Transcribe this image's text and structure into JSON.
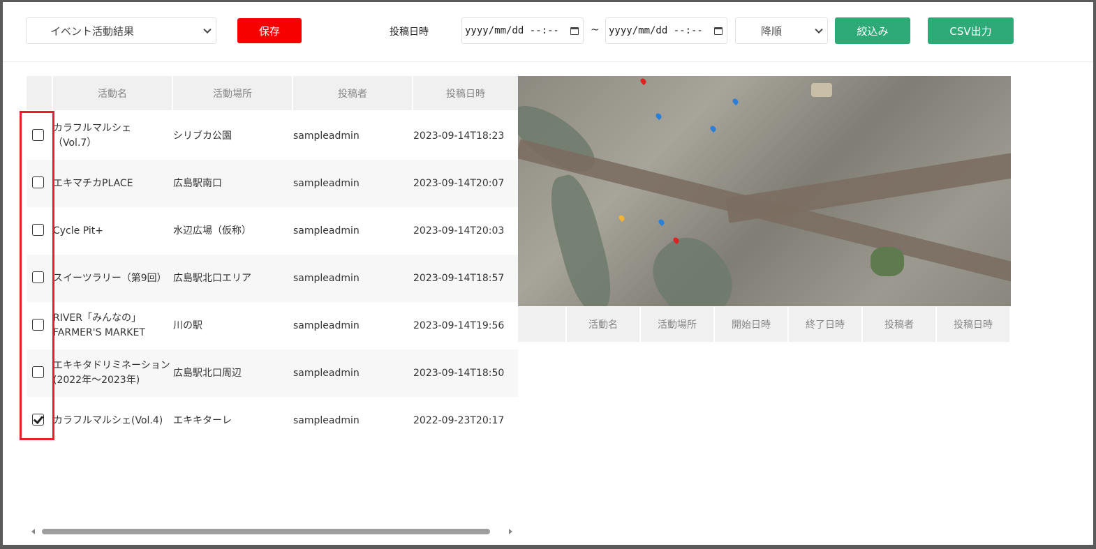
{
  "toolbar": {
    "type_select": "イベント活動結果",
    "save_label": "保存",
    "date_label": "投稿日時",
    "date_from_placeholder": "yyyy/mm/dd --:--",
    "date_to_placeholder": "yyyy/mm/dd --:--",
    "range_separator": "~",
    "order_select": "降順",
    "filter_label": "絞込み",
    "csv_label": "CSV出力"
  },
  "table": {
    "columns": [
      "活動名",
      "活動場所",
      "投稿者",
      "投稿日時"
    ],
    "rows": [
      {
        "name": "カラフルマルシェ（Vol.7）",
        "name_line1": "カラフルマルシェ",
        "name_line2": "（Vol.7）",
        "place": "シリブカ公園",
        "poster": "sampleadmin",
        "date": "2023-09-14T18:23",
        "checked": false
      },
      {
        "name_line1": "エキマチカPLACE",
        "name_line2": "",
        "place": "広島駅南口",
        "poster": "sampleadmin",
        "date": "2023-09-14T20:07",
        "checked": false
      },
      {
        "name_line1": "Cycle Pit+",
        "name_line2": "",
        "place": "水辺広場（仮称）",
        "poster": "sampleadmin",
        "date": "2023-09-14T20:03",
        "checked": false
      },
      {
        "name_line1": "スイーツラリー（第9回）",
        "name_line2": "",
        "place": "広島駅北口エリア",
        "poster": "sampleadmin",
        "date": "2023-09-14T18:57",
        "checked": false
      },
      {
        "name_line1": "RIVER「みんなの」",
        "name_line2": "FARMER'S MARKET",
        "place": "川の駅",
        "poster": "sampleadmin",
        "date": "2023-09-14T19:56",
        "checked": false
      },
      {
        "name_line1": "エキキタドリミネーション",
        "name_line2": "(2022年～2023年)",
        "place": "広島駅北口周辺",
        "poster": "sampleadmin",
        "date": "2023-09-14T18:50",
        "checked": false
      },
      {
        "name_line1": "カラフルマルシェ(Vol.4)",
        "name_line2": "",
        "place": "エキキターレ",
        "poster": "sampleadmin",
        "date": "2022-09-23T20:17",
        "checked": true
      }
    ]
  },
  "detail_table": {
    "columns": [
      "活動名",
      "活動場所",
      "開始日時",
      "終了日時",
      "投稿者",
      "投稿日時"
    ]
  },
  "colors": {
    "save": "#f70000",
    "primary": "#2eaa76",
    "highlight": "#e5202a"
  }
}
